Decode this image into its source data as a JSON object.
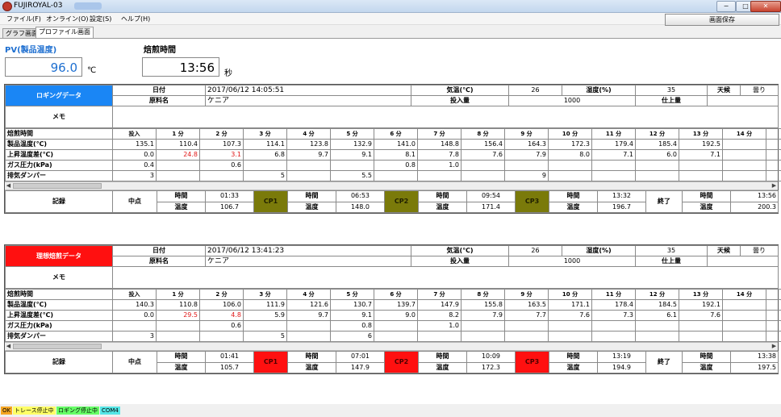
{
  "window": {
    "title": "FUJIROYAL-03",
    "min": "−",
    "max": "□",
    "close": "✕"
  },
  "menu": [
    "ファイル(F)",
    "オンライン(O)",
    "設定(S)",
    "ヘルプ(H)"
  ],
  "save_button": "画面保存",
  "tabs": [
    "グラフ画面",
    "プロファイル画面"
  ],
  "pv": {
    "label": "PV(製品温度)",
    "value": "96.0",
    "unit": "℃"
  },
  "roast_time": {
    "label": "焙煎時間",
    "value": "13:56",
    "unit": "秒"
  },
  "labels": {
    "date": "日付",
    "air_temp": "気温(℃)",
    "humidity": "湿度(%)",
    "weather": "天候",
    "bean": "原料名",
    "input": "投入量",
    "finish": "仕上量",
    "memo": "メモ",
    "roast_time_row": "焙煎時間",
    "prod_temp": "製品温度(℃)",
    "rise": "上昇温度差(℃)",
    "gas": "ガス圧力(kPa)",
    "damper": "排気ダンパー",
    "record": "記録",
    "midpoint": "中点",
    "time": "時間",
    "temp": "温度",
    "end": "終了"
  },
  "time_headers": [
    "投入",
    "1 分",
    "2 分",
    "3 分",
    "4 分",
    "5 分",
    "6 分",
    "7 分",
    "8 分",
    "9 分",
    "10 分",
    "11 分",
    "12 分",
    "13 分",
    "14 分",
    "15 分"
  ],
  "logging": {
    "header": "ロギングデータ",
    "date": "2017/06/12 14:05:51",
    "air_temp": "26",
    "humidity": "35",
    "weather": "曇り",
    "bean": "ケニア",
    "input": "1000",
    "finish": "",
    "prod_temp": [
      "135.1",
      "110.4",
      "107.3",
      "114.1",
      "123.8",
      "132.9",
      "141.0",
      "148.8",
      "156.4",
      "164.3",
      "172.3",
      "179.4",
      "185.4",
      "192.5",
      "",
      ""
    ],
    "rise": [
      "0.0",
      "24.8",
      "3.1",
      "6.8",
      "9.7",
      "9.1",
      "8.1",
      "7.8",
      "7.6",
      "7.9",
      "8.0",
      "7.1",
      "6.0",
      "7.1",
      "",
      ""
    ],
    "gas": [
      "0.4",
      "",
      "0.6",
      "",
      "",
      "",
      "0.8",
      "1.0",
      "",
      "",
      "",
      "",
      "",
      "",
      "",
      ""
    ],
    "damper": [
      "3",
      "",
      "",
      "5",
      "",
      "5.5",
      "",
      "",
      "",
      "9",
      "",
      "",
      "",
      "",
      "",
      ""
    ],
    "mid_time": "01:33",
    "mid_temp": "106.7",
    "cp1": "CP1",
    "cp1_time": "06:53",
    "cp1_temp": "148.0",
    "cp2": "CP2",
    "cp2_time": "09:54",
    "cp2_temp": "171.4",
    "cp3": "CP3",
    "cp3_time": "13:32",
    "cp3_temp": "196.7",
    "end_time": "13:56",
    "end_temp": "200.3"
  },
  "ideal": {
    "header": "理想焙煎データ",
    "date": "2017/06/12 13:41:23",
    "air_temp": "26",
    "humidity": "35",
    "weather": "曇り",
    "bean": "ケニア",
    "input": "1000",
    "finish": "",
    "prod_temp": [
      "140.3",
      "110.8",
      "106.0",
      "111.9",
      "121.6",
      "130.7",
      "139.7",
      "147.9",
      "155.8",
      "163.5",
      "171.1",
      "178.4",
      "184.5",
      "192.1",
      "",
      ""
    ],
    "rise": [
      "0.0",
      "29.5",
      "4.8",
      "5.9",
      "9.7",
      "9.1",
      "9.0",
      "8.2",
      "7.9",
      "7.7",
      "7.6",
      "7.3",
      "6.1",
      "7.6",
      "",
      ""
    ],
    "gas": [
      "",
      "",
      "0.6",
      "",
      "",
      "0.8",
      "",
      "1.0",
      "",
      "",
      "",
      "",
      "",
      "",
      "",
      ""
    ],
    "damper": [
      "3",
      "",
      "",
      "5",
      "",
      "6",
      "",
      "",
      "",
      "",
      "",
      "",
      "",
      "",
      "",
      ""
    ],
    "mid_time": "01:41",
    "mid_temp": "105.7",
    "cp1": "CP1",
    "cp1_time": "07:01",
    "cp1_temp": "147.9",
    "cp2": "CP2",
    "cp2_time": "10:09",
    "cp2_temp": "172.3",
    "cp3": "CP3",
    "cp3_time": "13:19",
    "cp3_temp": "194.9",
    "end_time": "13:38",
    "end_temp": "197.5"
  },
  "status": {
    "ok": "OK",
    "trace": "トレース停止中",
    "logging": "ロギング停止中",
    "com": "COM4"
  },
  "colors": {
    "logging_header": "#1a86f5",
    "ideal_header": "#ff1010",
    "cp_logging": "#7a7a0a",
    "cp_ideal": "#ff1010",
    "pv_label": "#1e6fd0",
    "rise_highlight": "#e01818"
  }
}
